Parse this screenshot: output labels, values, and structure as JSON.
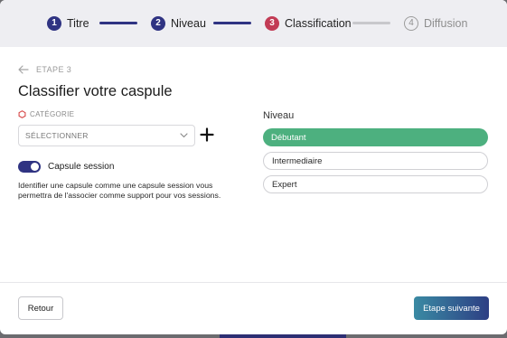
{
  "stepper": {
    "steps": [
      {
        "number": "1",
        "label": "Titre",
        "state": "done"
      },
      {
        "number": "2",
        "label": "Niveau",
        "state": "done"
      },
      {
        "number": "3",
        "label": "Classification",
        "state": "active"
      },
      {
        "number": "4",
        "label": "Diffusion",
        "state": "todo"
      }
    ]
  },
  "header": {
    "back_label": "ETAPE 3",
    "title": "Classifier votre caspule"
  },
  "category": {
    "label": "CATÉGORIE",
    "select_value": "SÉLECTIONNER",
    "add_icon": "plus-icon"
  },
  "capsule_session": {
    "label": "Capsule session",
    "enabled": true,
    "description": "Identifier une capsule comme une capsule session vous permettra de l'associer comme support pour vos sessions."
  },
  "niveau": {
    "title": "Niveau",
    "options": [
      {
        "label": "Débutant",
        "selected": true
      },
      {
        "label": "Intermediaire",
        "selected": false
      },
      {
        "label": "Expert",
        "selected": false
      }
    ]
  },
  "footer": {
    "back_button": "Retour",
    "next_button": "Etape suivante"
  },
  "colors": {
    "primary": "#2f3382",
    "active_step": "#c23b55",
    "selected_level": "#4db07f"
  }
}
